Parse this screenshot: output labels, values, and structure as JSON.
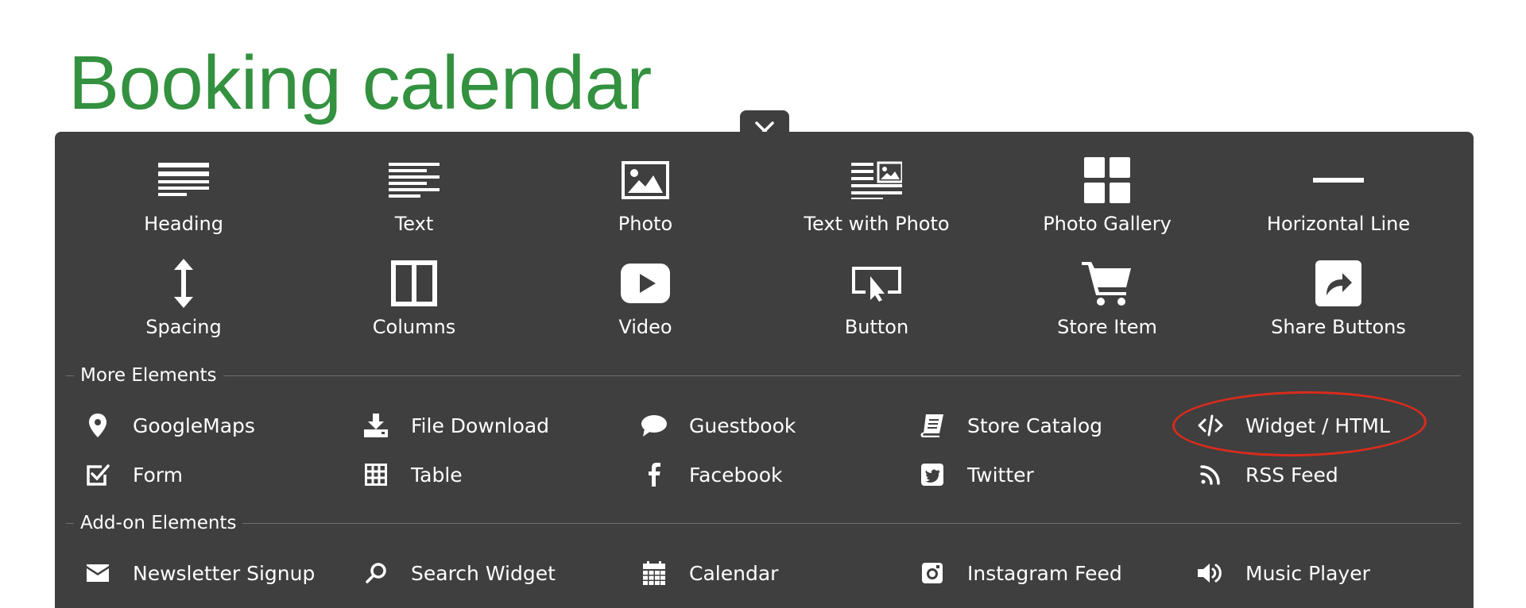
{
  "page": {
    "title": "Booking calendar"
  },
  "panel": {
    "close_icon": "close-icon",
    "basic_elements": [
      {
        "label": "Heading",
        "icon": "heading-icon"
      },
      {
        "label": "Text",
        "icon": "text-icon"
      },
      {
        "label": "Photo",
        "icon": "photo-icon"
      },
      {
        "label": "Text with Photo",
        "icon": "text-with-photo-icon"
      },
      {
        "label": "Photo Gallery",
        "icon": "photo-gallery-icon"
      },
      {
        "label": "Horizontal Line",
        "icon": "horizontal-line-icon"
      },
      {
        "label": "Spacing",
        "icon": "spacing-icon"
      },
      {
        "label": "Columns",
        "icon": "columns-icon"
      },
      {
        "label": "Video",
        "icon": "video-icon"
      },
      {
        "label": "Button",
        "icon": "button-icon"
      },
      {
        "label": "Store Item",
        "icon": "cart-icon"
      },
      {
        "label": "Share Buttons",
        "icon": "share-icon"
      }
    ],
    "more_elements": {
      "title": "More Elements",
      "items": [
        {
          "label": "GoogleMaps",
          "icon": "map-pin-icon"
        },
        {
          "label": "File Download",
          "icon": "download-icon"
        },
        {
          "label": "Guestbook",
          "icon": "speech-bubble-icon"
        },
        {
          "label": "Store Catalog",
          "icon": "book-icon"
        },
        {
          "label": "Widget / HTML",
          "icon": "code-icon"
        },
        {
          "label": "Form",
          "icon": "checkbox-icon"
        },
        {
          "label": "Table",
          "icon": "table-icon"
        },
        {
          "label": "Facebook",
          "icon": "facebook-icon"
        },
        {
          "label": "Twitter",
          "icon": "twitter-icon"
        },
        {
          "label": "RSS Feed",
          "icon": "rss-icon"
        }
      ]
    },
    "addon_elements": {
      "title": "Add-on Elements",
      "items": [
        {
          "label": "Newsletter Signup",
          "icon": "envelope-icon"
        },
        {
          "label": "Search Widget",
          "icon": "search-icon"
        },
        {
          "label": "Calendar",
          "icon": "calendar-icon"
        },
        {
          "label": "Instagram Feed",
          "icon": "instagram-icon"
        },
        {
          "label": "Music Player",
          "icon": "speaker-icon"
        }
      ]
    },
    "highlight_color": "#d92b1c"
  },
  "colors": {
    "title": "#33913f",
    "panel": "#3f3f3f",
    "text": "#ffffff"
  }
}
